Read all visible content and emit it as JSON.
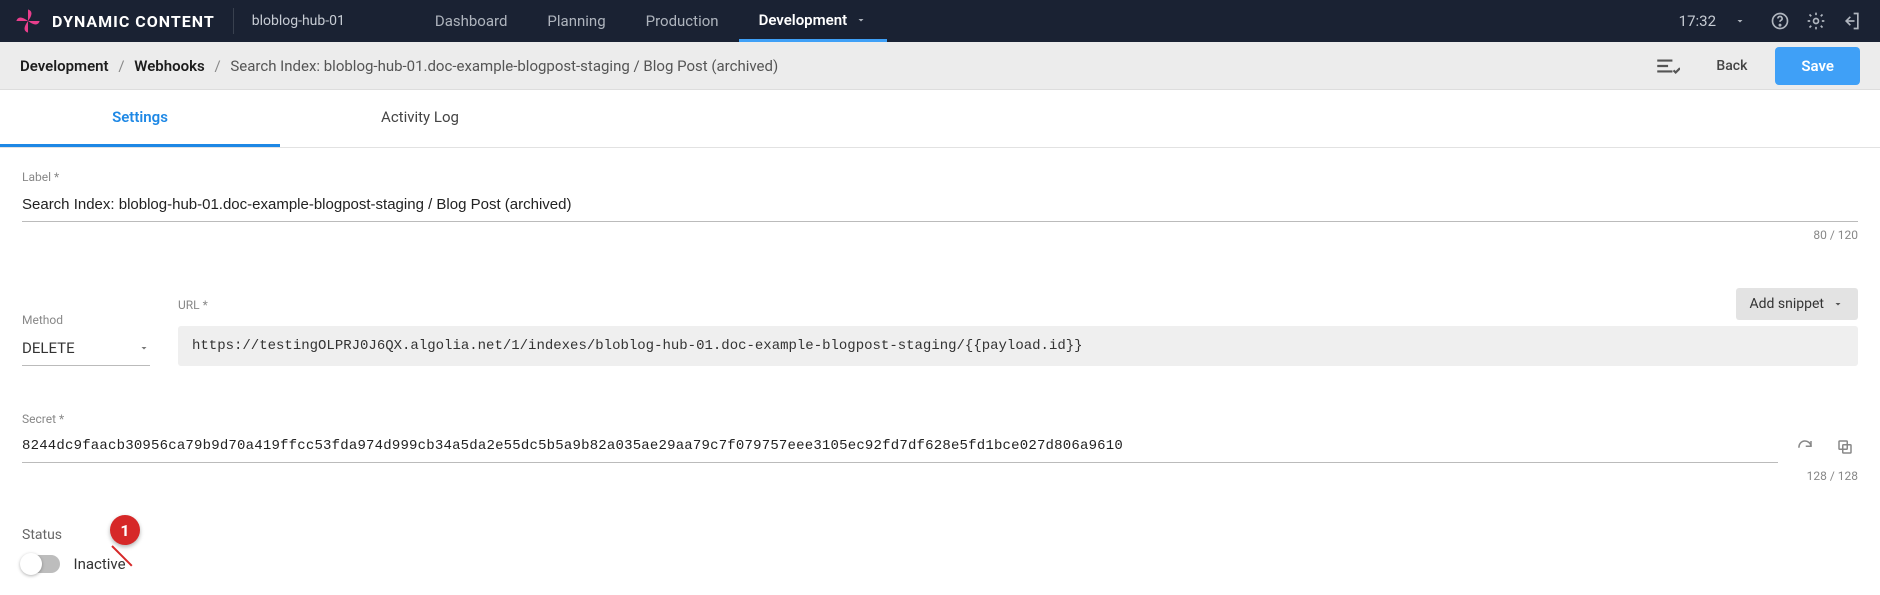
{
  "app": {
    "name": "DYNAMIC CONTENT",
    "hub": "bloblog-hub-01",
    "time": "17:32"
  },
  "nav": {
    "items": [
      {
        "label": "Dashboard"
      },
      {
        "label": "Planning"
      },
      {
        "label": "Production"
      },
      {
        "label": "Development",
        "active": true
      }
    ]
  },
  "breadcrumb": {
    "root": "Development",
    "section": "Webhooks",
    "current": "Search Index: bloblog-hub-01.doc-example-blogpost-staging / Blog Post (archived)"
  },
  "actions": {
    "back": "Back",
    "save": "Save"
  },
  "tabs": [
    {
      "label": "Settings",
      "active": true
    },
    {
      "label": "Activity Log"
    }
  ],
  "form": {
    "label_field": {
      "label": "Label *",
      "value": "Search Index: bloblog-hub-01.doc-example-blogpost-staging / Blog Post (archived)",
      "counter": "80 / 120"
    },
    "method": {
      "label": "Method",
      "value": "DELETE"
    },
    "url": {
      "label": "URL *",
      "value": "https://testingOLPRJ0J6QX.algolia.net/1/indexes/bloblog-hub-01.doc-example-blogpost-staging/{{payload.id}}"
    },
    "snippet_button": "Add snippet",
    "secret": {
      "label": "Secret *",
      "value": "8244dc9faacb30956ca79b9d70a419ffcc53fda974d999cb34a5da2e55dc5b5a9b82a035ae29aa79c7f079757eee3105ec92fd7df628e5fd1bce027d806a9610",
      "counter": "128 / 128"
    },
    "status": {
      "label": "Status",
      "value": "Inactive"
    }
  },
  "annotation": {
    "one": "1"
  }
}
